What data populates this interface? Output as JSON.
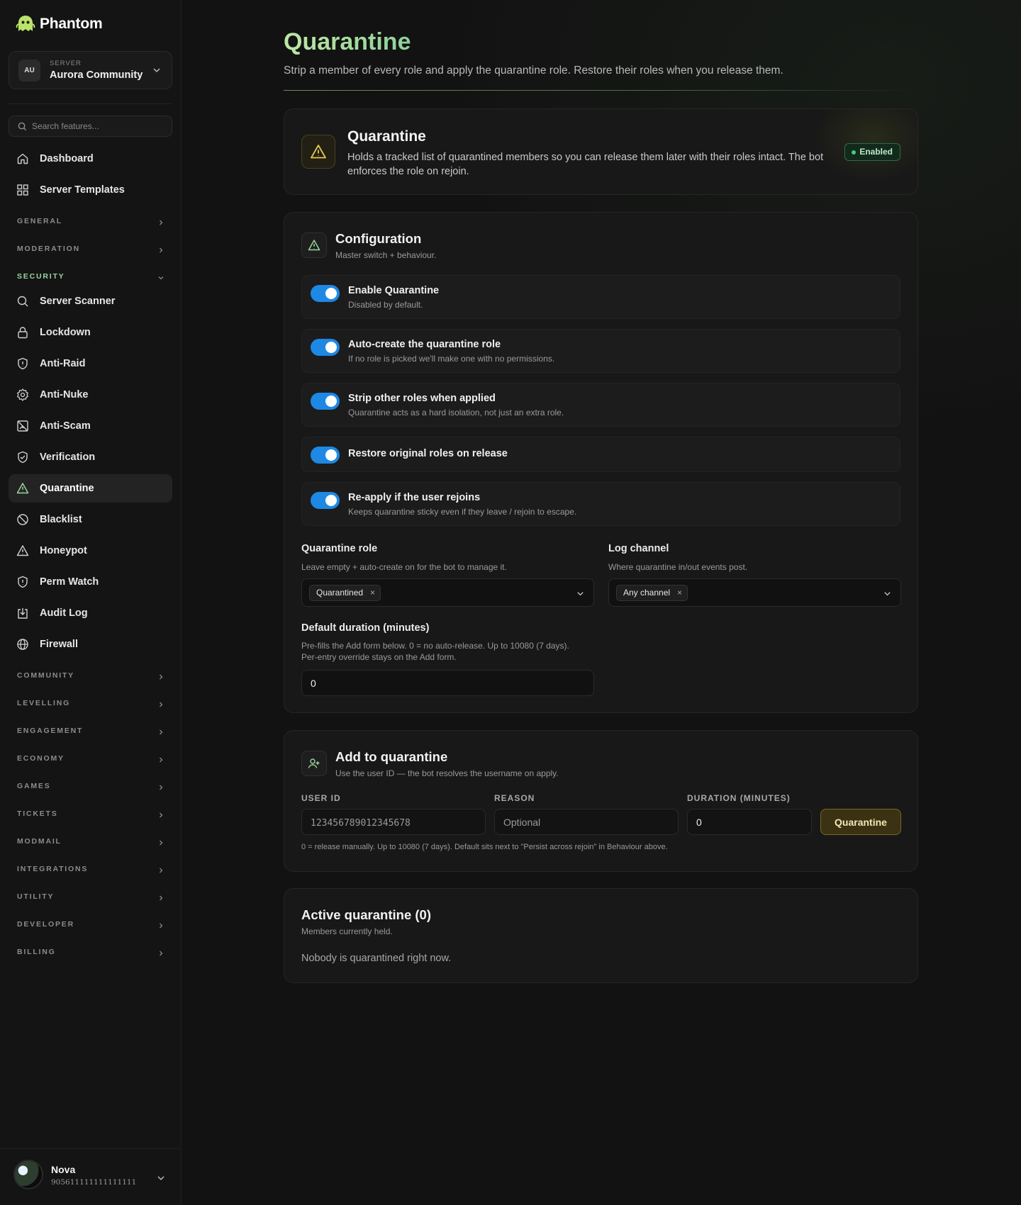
{
  "brand": {
    "name": "Phantom"
  },
  "server": {
    "caption": "SERVER",
    "avatar": "AU",
    "name": "Aurora Community"
  },
  "search": {
    "placeholder": "Search features..."
  },
  "nav_top": [
    {
      "label": "Dashboard",
      "icon": "home-icon"
    },
    {
      "label": "Server Templates",
      "icon": "grid-icon"
    }
  ],
  "sections": {
    "general": "GENERAL",
    "moderation": "MODERATION",
    "security": "SECURITY",
    "community": "COMMUNITY",
    "levelling": "LEVELLING",
    "engagement": "ENGAGEMENT",
    "economy": "ECONOMY",
    "games": "GAMES",
    "tickets": "TICKETS",
    "modmail": "MODMAIL",
    "integrations": "INTEGRATIONS",
    "utility": "UTILITY",
    "developer": "DEVELOPER",
    "billing": "BILLING"
  },
  "security_items": [
    {
      "label": "Server Scanner",
      "icon": "search-icon"
    },
    {
      "label": "Lockdown",
      "icon": "lock-icon"
    },
    {
      "label": "Anti-Raid",
      "icon": "shield-alert-icon"
    },
    {
      "label": "Anti-Nuke",
      "icon": "gear-burst-icon"
    },
    {
      "label": "Anti-Scam",
      "icon": "image-off-icon"
    },
    {
      "label": "Verification",
      "icon": "shield-check-icon"
    },
    {
      "label": "Quarantine",
      "icon": "warning-triangle-icon",
      "active": true
    },
    {
      "label": "Blacklist",
      "icon": "ban-icon"
    },
    {
      "label": "Honeypot",
      "icon": "warning-triangle-icon"
    },
    {
      "label": "Perm Watch",
      "icon": "shield-alert-icon"
    },
    {
      "label": "Audit Log",
      "icon": "download-box-icon"
    },
    {
      "label": "Firewall",
      "icon": "globe-icon"
    }
  ],
  "user": {
    "name": "Nova",
    "id": "905611111111111111"
  },
  "page": {
    "title": "Quarantine",
    "subtitle": "Strip a member of every role and apply the quarantine role. Restore their roles when you release them."
  },
  "hero": {
    "title": "Quarantine",
    "description": "Holds a tracked list of quarantined members so you can release them later with their roles intact. The bot enforces the role on rejoin.",
    "status": "Enabled"
  },
  "config": {
    "title": "Configuration",
    "subtitle": "Master switch + behaviour.",
    "toggles": [
      {
        "title": "Enable Quarantine",
        "subtitle": "Disabled by default.",
        "on": true
      },
      {
        "title": "Auto-create the quarantine role",
        "subtitle": "If no role is picked we'll make one with no permissions.",
        "on": true
      },
      {
        "title": "Strip other roles when applied",
        "subtitle": "Quarantine acts as a hard isolation, not just an extra role.",
        "on": true
      },
      {
        "title": "Restore original roles on release",
        "subtitle": "",
        "on": true
      },
      {
        "title": "Re-apply if the user rejoins",
        "subtitle": "Keeps quarantine sticky even if they leave / rejoin to escape.",
        "on": true
      }
    ],
    "role": {
      "label": "Quarantine role",
      "help": "Leave empty + auto-create on for the bot to manage it.",
      "value": "Quarantined"
    },
    "log": {
      "label": "Log channel",
      "help": "Where quarantine in/out events post.",
      "value": "Any channel"
    },
    "duration": {
      "label": "Default duration (minutes)",
      "help_line1": "Pre-fills the Add form below. 0 = no auto-release. Up to 10080 (7 days).",
      "help_line2": "Per-entry override stays on the Add form.",
      "value": "0"
    }
  },
  "add": {
    "title": "Add to quarantine",
    "subtitle": "Use the user ID — the bot resolves the username on apply.",
    "user_id_label": "USER ID",
    "user_id_placeholder": "123456789012345678",
    "reason_label": "REASON",
    "reason_placeholder": "Optional",
    "duration_label": "DURATION (MINUTES)",
    "duration_value": "0",
    "button": "Quarantine",
    "help": "0 = release manually. Up to 10080 (7 days). Default sits next to \"Persist across rejoin\" in Behaviour above."
  },
  "active": {
    "title": "Active quarantine (0)",
    "subtitle": "Members currently held.",
    "empty": "Nobody is quarantined right now."
  },
  "colors": {
    "accent_green": "#9ad59f",
    "toggle_blue": "#1e88e5",
    "warning_yellow": "#e6c84a",
    "enabled_green": "#3fd07a"
  }
}
